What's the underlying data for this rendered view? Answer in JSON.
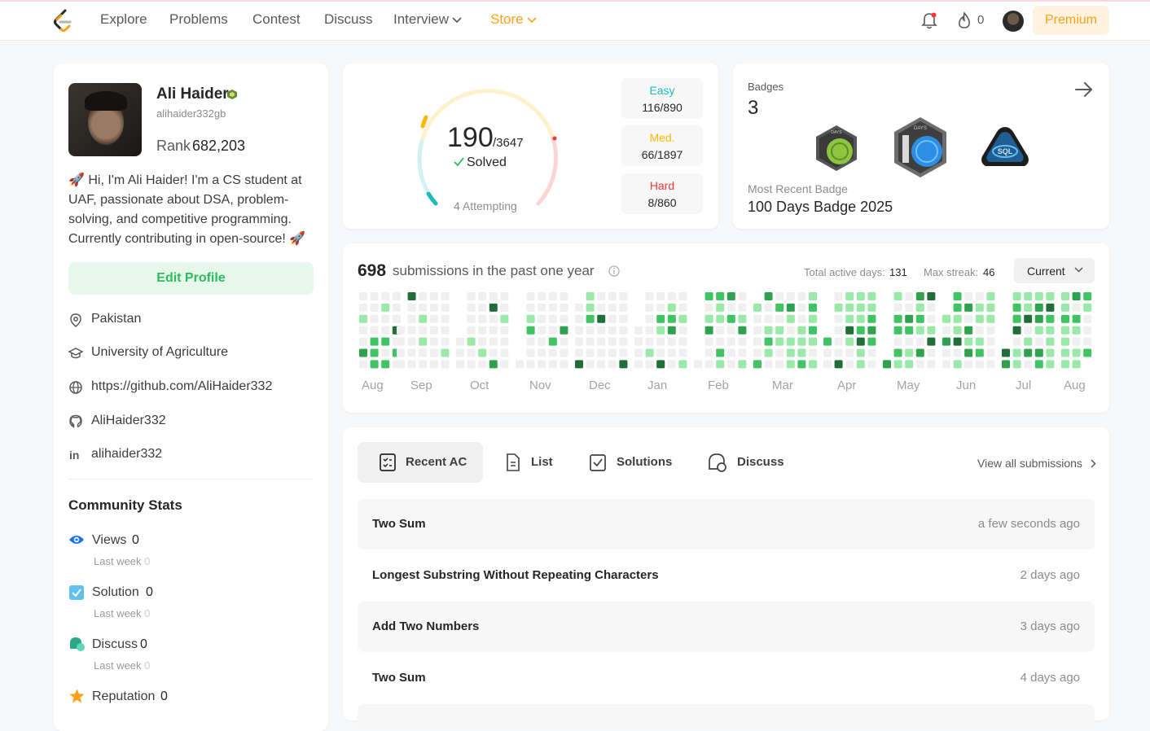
{
  "nav": {
    "items": [
      "Explore",
      "Problems",
      "Contest",
      "Discuss"
    ],
    "interview": "Interview",
    "store": "Store",
    "streak": "0",
    "premium": "Premium",
    "store_color": "#ffa116"
  },
  "profile": {
    "name": "Ali Haider",
    "username": "alihaider332gb",
    "rank_label": "Rank",
    "rank": "682,203",
    "bio": "🚀 Hi, I'm Ali Haider! I'm a CS student at UAF, passionate about DSA, problem-solving, and competitive programming. Currently contributing in open-source! 🚀",
    "edit_button": "Edit Profile",
    "location": "Pakistan",
    "school": "University of Agriculture",
    "website": "https://github.com/AliHaider332",
    "github": "AliHaider332",
    "linkedin": "alihaider332"
  },
  "community": {
    "title": "Community Stats",
    "last_week_label": "Last week",
    "stats": [
      {
        "label": "Views",
        "value": "0",
        "last_week": "0",
        "icon": "eye-icon"
      },
      {
        "label": "Solution",
        "value": "0",
        "last_week": "0",
        "icon": "check-square-icon"
      },
      {
        "label": "Discuss",
        "value": "0",
        "last_week": "0",
        "icon": "chat-icon"
      },
      {
        "label": "Reputation",
        "value": "0",
        "icon": "star-icon"
      }
    ]
  },
  "solved": {
    "count": "190",
    "total": "/3647",
    "label": "Solved",
    "attempting": "4 Attempting",
    "difficulty": [
      {
        "label": "Easy",
        "value": "116/890",
        "color": "#1cbaba",
        "solved": 116,
        "total": 890
      },
      {
        "label": "Med.",
        "value": "66/1897",
        "color": "#ffb800",
        "solved": 66,
        "total": 1897
      },
      {
        "label": "Hard",
        "value": "8/860",
        "color": "#f63737",
        "solved": 8,
        "total": 860
      }
    ]
  },
  "badges": {
    "title": "Badges",
    "count": "3",
    "recent_label": "Most Recent Badge",
    "recent_name": "100 Days Badge 2025",
    "items": [
      "50-days-badge-icon",
      "100-days-badge-icon",
      "sql-badge-icon"
    ],
    "badge_texts": [
      "DAYS",
      "DAYS",
      "SQL"
    ]
  },
  "calendar": {
    "count": "698",
    "label": "submissions in the past one year",
    "active_label": "Total active days:",
    "active": "131",
    "streak_label": "Max streak:",
    "streak": "46",
    "select": "Current",
    "months": [
      "Aug",
      "Sep",
      "Oct",
      "Nov",
      "Dec",
      "Jan",
      "Feb",
      "Mar",
      "Apr",
      "May",
      "Jun",
      "Jul",
      "Aug"
    ],
    "levels_colors": [
      "#ebebeb",
      "#9be9a8",
      "#40c463",
      "#30a14e",
      "#216e39"
    ]
  },
  "recent": {
    "tabs": [
      "Recent AC",
      "List",
      "Solutions",
      "Discuss"
    ],
    "view_all": "View all submissions",
    "rows": [
      {
        "title": "Two Sum",
        "time": "a few seconds ago"
      },
      {
        "title": "Longest Substring Without Repeating Characters",
        "time": "2 days ago"
      },
      {
        "title": "Add Two Numbers",
        "time": "3 days ago"
      },
      {
        "title": "Two Sum",
        "time": "4 days ago"
      }
    ]
  }
}
